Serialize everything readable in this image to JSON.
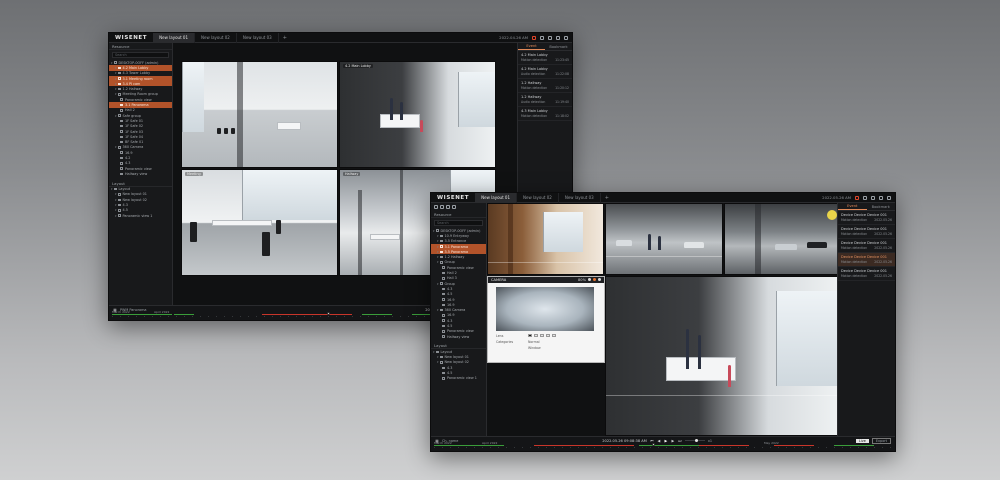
{
  "back_window": {
    "logo": "WISENET",
    "tabs": [
      "New layout 01",
      "New layout 02",
      "New layout 03"
    ],
    "tab_add": "+",
    "clock": "2022.04.26 AM",
    "sidebar": {
      "header": "Resource",
      "search_placeholder": "Search",
      "tree": [
        {
          "label": "DESKTOP-0OFF (admin)",
          "selected": false,
          "indent": 0
        },
        {
          "label": "4.2 Main Lobby",
          "selected": true,
          "indent": 1
        },
        {
          "label": "4.3 Tower Lobby",
          "selected": false,
          "indent": 1
        },
        {
          "label": "3.1 Meeting room",
          "selected": true,
          "indent": 1
        },
        {
          "label": "3.4 PI cam",
          "selected": true,
          "indent": 1
        },
        {
          "label": "1.2 Hallway",
          "selected": false,
          "indent": 1
        },
        {
          "label": "Meeting Room group",
          "selected": false,
          "indent": 1
        },
        {
          "label": "Panoramic view",
          "selected": false,
          "indent": 2
        },
        {
          "label": "3.1 Panorama",
          "selected": true,
          "indent": 2
        },
        {
          "label": "Hall 2",
          "selected": false,
          "indent": 2
        },
        {
          "label": "Safe group",
          "selected": false,
          "indent": 1
        },
        {
          "label": "1F Safe 01",
          "selected": false,
          "indent": 2
        },
        {
          "label": "1F Safe 02",
          "selected": false,
          "indent": 2
        },
        {
          "label": "1F Safe 03",
          "selected": false,
          "indent": 2
        },
        {
          "label": "1F Safe 04",
          "selected": false,
          "indent": 2
        },
        {
          "label": "BF Safe 01",
          "selected": false,
          "indent": 2
        },
        {
          "label": "360 Camera",
          "selected": false,
          "indent": 1
        },
        {
          "label": "16.9",
          "selected": false,
          "indent": 2
        },
        {
          "label": "4.2",
          "selected": false,
          "indent": 2
        },
        {
          "label": "4.3",
          "selected": false,
          "indent": 2
        },
        {
          "label": "Panoramic view",
          "selected": false,
          "indent": 2
        },
        {
          "label": "Hallway view",
          "selected": false,
          "indent": 2
        }
      ],
      "layout_header": "Layout",
      "layout_tree": [
        {
          "label": "Layout",
          "indent": 0
        },
        {
          "label": "New layout 01",
          "indent": 1
        },
        {
          "label": "New layout 02",
          "indent": 1
        },
        {
          "label": "4.3",
          "indent": 1
        },
        {
          "label": "4.5",
          "indent": 1
        },
        {
          "label": "Panoramic view 1",
          "indent": 1
        }
      ]
    },
    "cameras": [
      {
        "label": ""
      },
      {
        "label": "4.2 Main Lobby"
      },
      {
        "label": "Meeting"
      },
      {
        "label": "Hallway"
      }
    ],
    "event_panel": {
      "tabs": [
        "Event",
        "Bookmark"
      ],
      "items": [
        {
          "title": "4.2 Main Lobby",
          "sub": "Motion detection",
          "time": "11:23:45",
          "highlight": false
        },
        {
          "title": "4.2 Main Lobby",
          "sub": "Audio detection",
          "time": "11:22:08",
          "highlight": false
        },
        {
          "title": "1.2 Hallway",
          "sub": "Motion detection",
          "time": "11:20:12",
          "highlight": false
        },
        {
          "title": "1.2 Hallway",
          "sub": "Audio detection",
          "time": "11:19:40",
          "highlight": false
        },
        {
          "title": "4.3 Main Lobby",
          "sub": "Motion detection",
          "time": "11:18:02",
          "highlight": false
        }
      ]
    },
    "timeline": {
      "mode": "PWM Panorama",
      "current_time": "2022.04.26 11:23:11 AM",
      "speed": "x1",
      "date_left": "March 2022",
      "date_mid": "April 2022"
    }
  },
  "front_window": {
    "logo": "WISENET",
    "tabs": [
      "New layout 01",
      "New layout 02",
      "New layout 03"
    ],
    "tab_add": "+",
    "clock": "2022.05.26 AM",
    "sidebar": {
      "header": "Resource",
      "search_placeholder": "Search",
      "tree": [
        {
          "label": "DESKTOP-0OFF (admin)",
          "selected": false,
          "indent": 0
        },
        {
          "label": "10.9 Entryway",
          "selected": false,
          "indent": 1
        },
        {
          "label": "3.5 Entrance",
          "selected": false,
          "indent": 1
        },
        {
          "label": "3.1 Panorama",
          "selected": true,
          "indent": 1
        },
        {
          "label": "3.5 Panorama",
          "selected": true,
          "indent": 1
        },
        {
          "label": "1.2 Hallway",
          "selected": false,
          "indent": 1
        },
        {
          "label": "Group",
          "selected": false,
          "indent": 1
        },
        {
          "label": "Panoramic view",
          "selected": false,
          "indent": 2
        },
        {
          "label": "Hall 2",
          "selected": false,
          "indent": 2
        },
        {
          "label": "Hall 3",
          "selected": false,
          "indent": 2
        },
        {
          "label": "Group",
          "selected": false,
          "indent": 1
        },
        {
          "label": "4.3",
          "selected": false,
          "indent": 2
        },
        {
          "label": "4.5",
          "selected": false,
          "indent": 2
        },
        {
          "label": "16.9",
          "selected": false,
          "indent": 2
        },
        {
          "label": "16.9",
          "selected": false,
          "indent": 2
        },
        {
          "label": "360 Camera",
          "selected": false,
          "indent": 1
        },
        {
          "label": "16.9",
          "selected": false,
          "indent": 2
        },
        {
          "label": "4.3",
          "selected": false,
          "indent": 2
        },
        {
          "label": "4.5",
          "selected": false,
          "indent": 2
        },
        {
          "label": "Panoramic view",
          "selected": false,
          "indent": 2
        },
        {
          "label": "Hallway view",
          "selected": false,
          "indent": 2
        }
      ],
      "layout_header": "Layout",
      "layout_tree": [
        {
          "label": "Layout",
          "indent": 0
        },
        {
          "label": "New layout 01",
          "indent": 1
        },
        {
          "label": "New layout 02",
          "indent": 1
        },
        {
          "label": "4.3",
          "indent": 2
        },
        {
          "label": "4.5",
          "indent": 2
        },
        {
          "label": "Panoramic view 1",
          "indent": 2
        }
      ]
    },
    "popup": {
      "title": "CAMERA",
      "zoom": "80%",
      "rows": [
        "Lens",
        "Categories",
        "Window"
      ],
      "option_label": "Normal"
    },
    "event_panel": {
      "tabs": [
        "Event",
        "Bookmark"
      ],
      "items": [
        {
          "title": "Device Device Device 001",
          "sub": "Motion detection",
          "time": "2022.05.26",
          "highlight": false
        },
        {
          "title": "Device Device Device 001",
          "sub": "Motion detection",
          "time": "2022.05.26",
          "highlight": false
        },
        {
          "title": "Device Device Device 001",
          "sub": "Motion detection",
          "time": "2022.05.26",
          "highlight": false
        },
        {
          "title": "Device Device Device 001",
          "sub": "Motion detection",
          "time": "2022.05.26",
          "highlight": true
        },
        {
          "title": "Device Device Device 001",
          "sub": "Motion detection",
          "time": "2022.05.26",
          "highlight": false
        }
      ]
    },
    "timeline": {
      "mode": "Ch. name",
      "current_time": "2022.05.26 09:08:38 AM",
      "speed": "x1",
      "date_left": "March 2022",
      "date_mid": "April 2022",
      "date_right": "May 2022",
      "live_label": "Live",
      "export_label": "Export"
    }
  },
  "colors": {
    "accent": "#b2532a",
    "accent_light": "#e28a59",
    "timeline_green": "#3a9d3a",
    "timeline_red": "#c8352a",
    "background": "#1b1c1e"
  }
}
